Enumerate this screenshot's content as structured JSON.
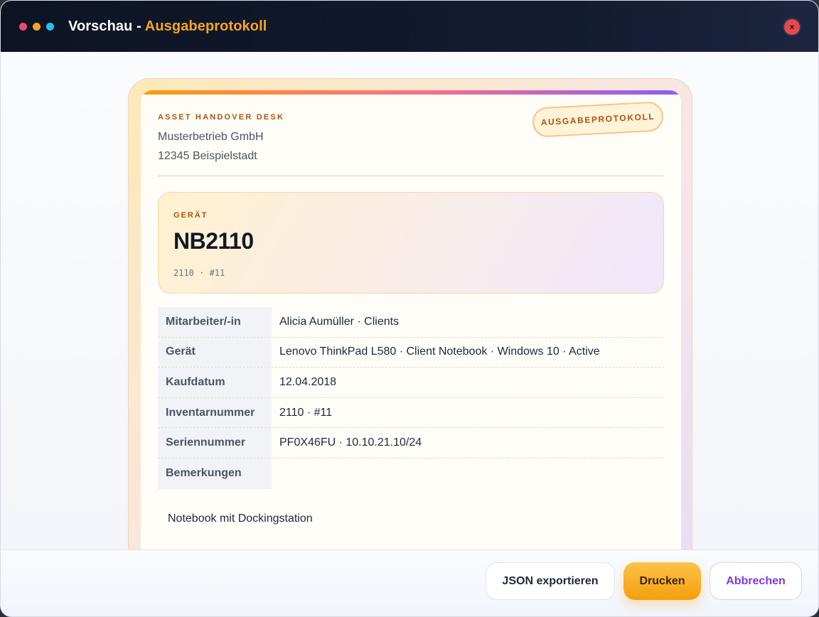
{
  "window": {
    "title_prefix": "Vorschau - ",
    "title_accent": "Ausgabeprotokoll",
    "close_glyph": "×"
  },
  "document": {
    "kicker": "ASSET HANDOVER DESK",
    "company": "Musterbetrieb GmbH",
    "city": "12345 Beispielstadt",
    "stamp": "AUSGABEPROTOKOLL",
    "device_label": "GERÄT",
    "device_name": "NB2110",
    "device_sub": "2110 · #11",
    "rows": [
      {
        "key": "Mitarbeiter/-in",
        "value": "Alicia Aumüller · Clients"
      },
      {
        "key": "Gerät",
        "value": "Lenovo ThinkPad L580 · Client Notebook · Windows 10 · Active"
      },
      {
        "key": "Kaufdatum",
        "value": "12.04.2018"
      },
      {
        "key": "Inventarnummer",
        "value": "2110 · #11"
      },
      {
        "key": "Seriennummer",
        "value": "PF0X46FU · 10.10.21.10/24"
      },
      {
        "key": "Bemerkungen",
        "value": ""
      }
    ],
    "notes": "Notebook mit Dockingstation"
  },
  "footer": {
    "json_label": "JSON exportieren",
    "print_label": "Drucken",
    "cancel_label": "Abbrechen"
  },
  "colors": {
    "accent": "#f5a524",
    "titlebar": "#0c1424",
    "close": "#e5484d",
    "cancel_text": "#7c3aed"
  },
  "icons": {
    "window_controls": [
      "red-dot-icon",
      "yellow-dot-icon",
      "cyan-dot-icon"
    ],
    "close": "close-icon"
  }
}
